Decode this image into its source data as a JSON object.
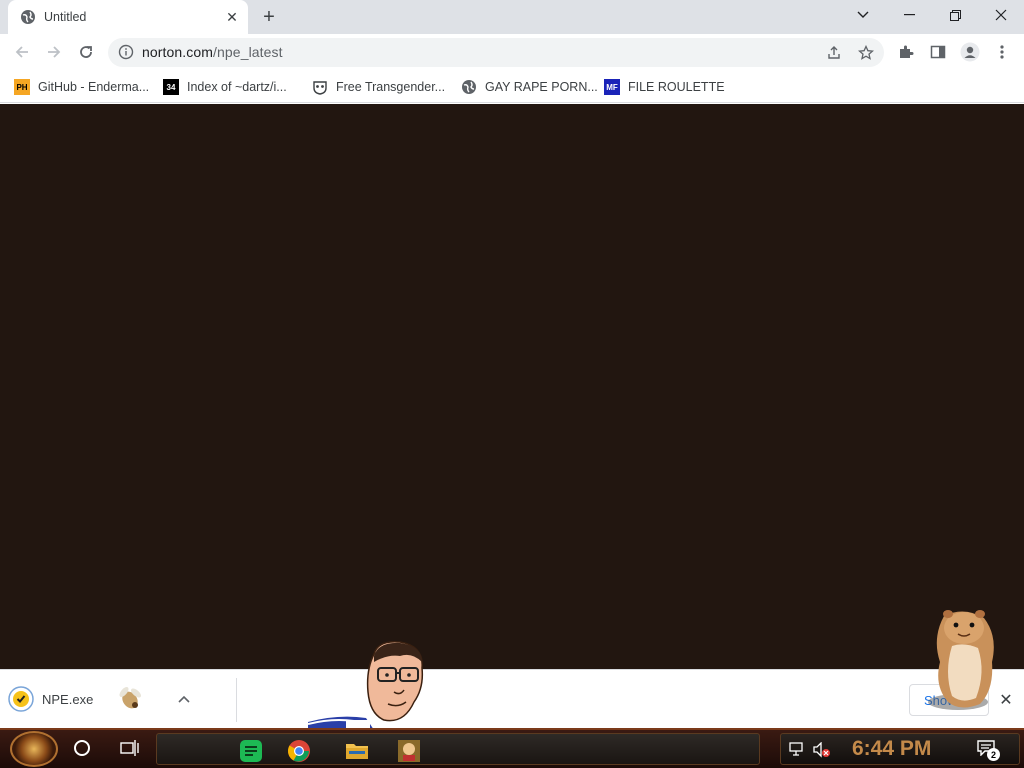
{
  "tab": {
    "title": "Untitled",
    "close_label": "✕"
  },
  "newtab_label": "+",
  "window": {
    "min": "—",
    "restore": "❐",
    "close": "✕",
    "tab_search": "⌄"
  },
  "omnibox": {
    "host": "norton.com",
    "path": "/npe_latest"
  },
  "bookmarks": [
    {
      "label": "GitHub - Enderma...",
      "icon": "PH",
      "icon_color": "#f5a623",
      "icon_text_color": "#000000"
    },
    {
      "label": "Index of ~dartz/i...",
      "icon": "34",
      "icon_color": "#000000",
      "icon_text_color": "#ffffff"
    },
    {
      "label": "Free Transgender...",
      "icon": "mask-icon",
      "icon_color": "#3c4043"
    },
    {
      "label": "GAY RAPE PORN...",
      "icon": "globe-icon",
      "icon_color": "#5f6368"
    },
    {
      "label": "FILE ROULETTE",
      "icon": "MF",
      "icon_color": "#1a23b8",
      "icon_text_color": "#ffffff"
    }
  ],
  "downloads": {
    "file_name": "NPE.exe",
    "show_all_label": "Show all",
    "close_label": "✕"
  },
  "taskbar": {
    "clock": "6:44 PM",
    "notifications_count": "2"
  },
  "colors": {
    "page_background": "#221610",
    "accent": "#1a73e8",
    "clock": "#c48a4a"
  }
}
